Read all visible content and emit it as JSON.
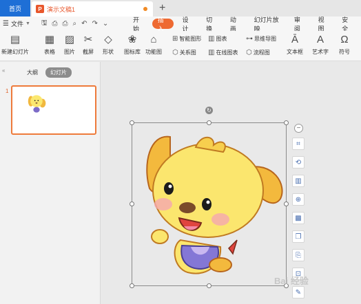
{
  "titlebar": {
    "home_tab": "首页",
    "doc_icon_letter": "P",
    "doc_title": "演示文稿1",
    "new_tab_symbol": "+"
  },
  "menubar": {
    "file_label": "文件",
    "tabs": [
      "开始",
      "插入",
      "设计",
      "切换",
      "动画",
      "幻灯片放映",
      "审阅",
      "视图",
      "安全"
    ],
    "active_tab": "插入"
  },
  "toolbar": {
    "new_slide": "新建幻灯片",
    "table": "表格",
    "picture": "图片",
    "screenshot": "截屏",
    "shape": "形状",
    "icon_library": "图标库",
    "function_chart": "功能图",
    "relation_chart": "关系图",
    "smart_graphic": "智能图形",
    "chart": "图表",
    "online_chart": "在线图表",
    "mind_map": "思维导图",
    "flowchart": "流程图",
    "text_box": "文本框",
    "word_art": "艺术字",
    "symbol": "符号"
  },
  "left_panel": {
    "outline_tab": "大纲",
    "slides_tab": "幻灯片",
    "slide_number": "1"
  },
  "canvas": {
    "watermark": "Bai 经验"
  },
  "icons": {
    "side_tools": [
      "crop-icon",
      "replace-picture-icon",
      "layout-icon",
      "zoom-icon",
      "texture-icon",
      "copy-style-icon",
      "export-icon",
      "cutout-icon",
      "more-edit-icon"
    ]
  },
  "colors": {
    "accent": "#ee6a32",
    "home_tab": "#1e6fd6",
    "selection_border": "#ee7a3a"
  }
}
